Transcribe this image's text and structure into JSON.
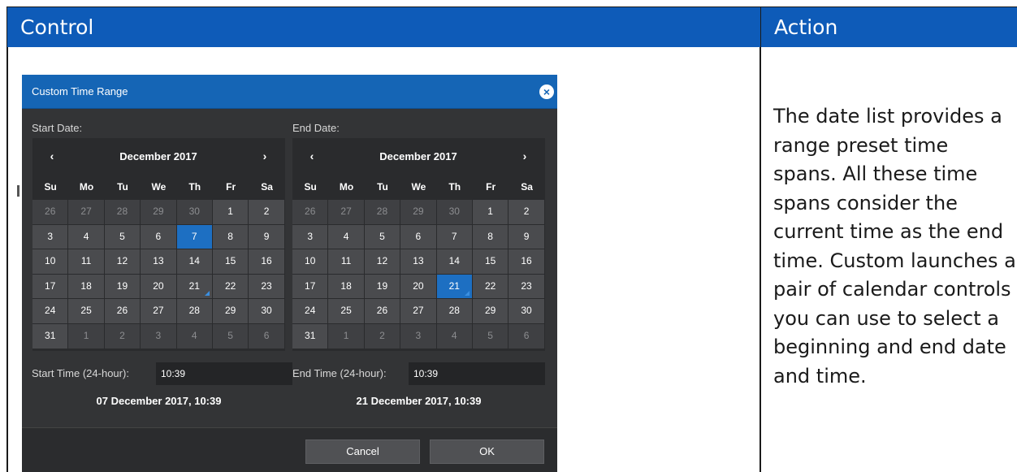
{
  "table": {
    "header_control": "Control",
    "header_action": "Action",
    "action_text": "The date list provides a range preset time spans. All these time spans consider the current time as the end time. Custom launches a pair of calendar controls you can use to select a beginning and end date and time."
  },
  "dialog": {
    "title": "Custom Time Range",
    "close_icon": "close-icon",
    "start": {
      "label": "Start Date:",
      "prev": "‹",
      "next": "›",
      "month": "December 2017",
      "dow": [
        "Su",
        "Mo",
        "Tu",
        "We",
        "Th",
        "Fr",
        "Sa"
      ],
      "days": [
        {
          "d": "26",
          "other": true
        },
        {
          "d": "27",
          "other": true
        },
        {
          "d": "28",
          "other": true
        },
        {
          "d": "29",
          "other": true
        },
        {
          "d": "30",
          "other": true
        },
        {
          "d": "1"
        },
        {
          "d": "2"
        },
        {
          "d": "3"
        },
        {
          "d": "4"
        },
        {
          "d": "5"
        },
        {
          "d": "6"
        },
        {
          "d": "7",
          "selected": true
        },
        {
          "d": "8"
        },
        {
          "d": "9"
        },
        {
          "d": "10"
        },
        {
          "d": "11"
        },
        {
          "d": "12"
        },
        {
          "d": "13"
        },
        {
          "d": "14"
        },
        {
          "d": "15"
        },
        {
          "d": "16"
        },
        {
          "d": "17"
        },
        {
          "d": "18"
        },
        {
          "d": "19"
        },
        {
          "d": "20"
        },
        {
          "d": "21",
          "today": true
        },
        {
          "d": "22"
        },
        {
          "d": "23"
        },
        {
          "d": "24"
        },
        {
          "d": "25"
        },
        {
          "d": "26"
        },
        {
          "d": "27"
        },
        {
          "d": "28"
        },
        {
          "d": "29"
        },
        {
          "d": "30"
        },
        {
          "d": "31"
        },
        {
          "d": "1",
          "other": true
        },
        {
          "d": "2",
          "other": true
        },
        {
          "d": "3",
          "other": true
        },
        {
          "d": "4",
          "other": true
        },
        {
          "d": "5",
          "other": true
        },
        {
          "d": "6",
          "other": true
        }
      ],
      "time_label": "Start Time (24-hour):",
      "time_value": "10:39",
      "summary": "07 December 2017, 10:39"
    },
    "end": {
      "label": "End Date:",
      "prev": "‹",
      "next": "›",
      "month": "December 2017",
      "dow": [
        "Su",
        "Mo",
        "Tu",
        "We",
        "Th",
        "Fr",
        "Sa"
      ],
      "days": [
        {
          "d": "26",
          "other": true
        },
        {
          "d": "27",
          "other": true
        },
        {
          "d": "28",
          "other": true
        },
        {
          "d": "29",
          "other": true
        },
        {
          "d": "30",
          "other": true
        },
        {
          "d": "1"
        },
        {
          "d": "2"
        },
        {
          "d": "3"
        },
        {
          "d": "4"
        },
        {
          "d": "5"
        },
        {
          "d": "6"
        },
        {
          "d": "7"
        },
        {
          "d": "8"
        },
        {
          "d": "9"
        },
        {
          "d": "10"
        },
        {
          "d": "11"
        },
        {
          "d": "12"
        },
        {
          "d": "13"
        },
        {
          "d": "14"
        },
        {
          "d": "15"
        },
        {
          "d": "16"
        },
        {
          "d": "17"
        },
        {
          "d": "18"
        },
        {
          "d": "19"
        },
        {
          "d": "20"
        },
        {
          "d": "21",
          "selected": true,
          "today": true
        },
        {
          "d": "22"
        },
        {
          "d": "23"
        },
        {
          "d": "24"
        },
        {
          "d": "25"
        },
        {
          "d": "26"
        },
        {
          "d": "27"
        },
        {
          "d": "28"
        },
        {
          "d": "29"
        },
        {
          "d": "30"
        },
        {
          "d": "31"
        },
        {
          "d": "1",
          "other": true
        },
        {
          "d": "2",
          "other": true
        },
        {
          "d": "3",
          "other": true
        },
        {
          "d": "4",
          "other": true
        },
        {
          "d": "5",
          "other": true
        },
        {
          "d": "6",
          "other": true
        }
      ],
      "time_label": "End Time (24-hour):",
      "time_value": "10:39",
      "summary": "21 December 2017, 10:39"
    },
    "cancel_label": "Cancel",
    "ok_label": "OK"
  },
  "colors": {
    "header_blue": "#0e5bb8",
    "dialog_title_blue": "#1565b5",
    "selected_day": "#1d6fc2"
  }
}
